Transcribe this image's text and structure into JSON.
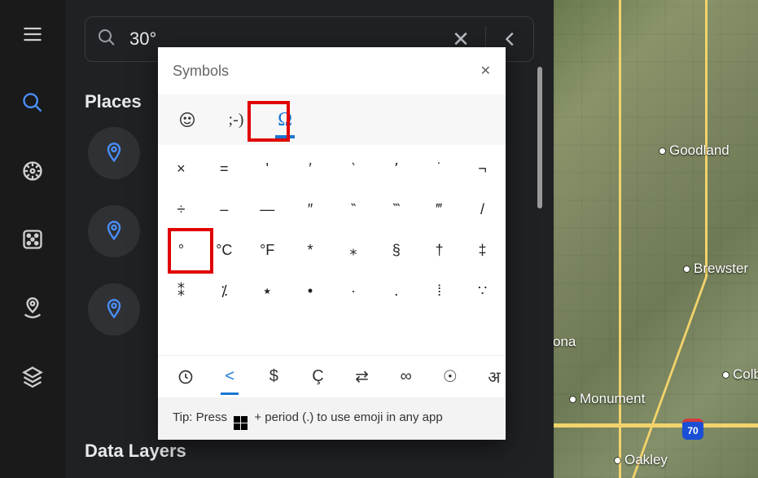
{
  "search": {
    "value": "30°",
    "placeholder": ""
  },
  "sections": {
    "places": "Places",
    "datalayers": "Data Layers"
  },
  "popup": {
    "title": "Symbols",
    "tabs": {
      "emoji": "☺",
      "kaomoji": ";-)",
      "symbols": "Ω"
    },
    "grid": [
      "×",
      "=",
      "ʹ",
      "′",
      "‵",
      "٬",
      "˙",
      "¬",
      "÷",
      "–",
      "—",
      "″",
      "‶",
      "‷",
      "‴",
      "/",
      "°",
      "°C",
      "°F",
      "*",
      "⁎",
      "§",
      "†",
      "‡",
      "⁑",
      "⁒",
      "٭",
      "•",
      "·",
      "․",
      "⁞",
      "∵"
    ],
    "categories": [
      "clock",
      "<",
      "$",
      "Ç",
      "⇄",
      "∞",
      "☉",
      "अ"
    ],
    "tip_pre": "Tip: Press ",
    "tip_post": " + period (.) to use emoji in any app"
  },
  "map": {
    "cities": {
      "goodland": "Goodland",
      "brewster": "Brewster",
      "colby": "Colby",
      "monument": "Monument",
      "oakley": "Oakley",
      "ona": "ona"
    },
    "shield": "70"
  }
}
